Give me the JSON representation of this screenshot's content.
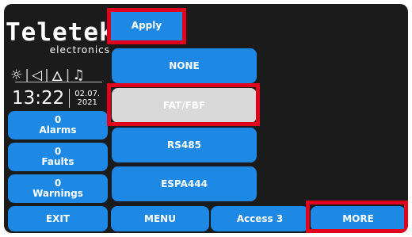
{
  "brand": {
    "name": "Teletek",
    "tagline": "electronics"
  },
  "status_icons": [
    "sun-icon",
    "speaker-icon",
    "fire-icon",
    "bell-icon"
  ],
  "clock": {
    "time": "13:22",
    "date_line1": "02.07.",
    "date_line2": "2021"
  },
  "counters": [
    {
      "count": "0",
      "label": "Alarms"
    },
    {
      "count": "0",
      "label": "Faults"
    },
    {
      "count": "0",
      "label": "Warnings"
    }
  ],
  "apply_label": "Apply",
  "options": [
    "NONE",
    "FAT/FBF",
    "RS485",
    "ESPA444"
  ],
  "bottom": {
    "exit": "EXIT",
    "menu": "MENU",
    "access": "Access 3",
    "more": "MORE"
  },
  "colors": {
    "accent": "#1e88e5",
    "background": "#1b1b1b",
    "highlight": "#e0001b",
    "disabled": "#d9d9d9"
  }
}
